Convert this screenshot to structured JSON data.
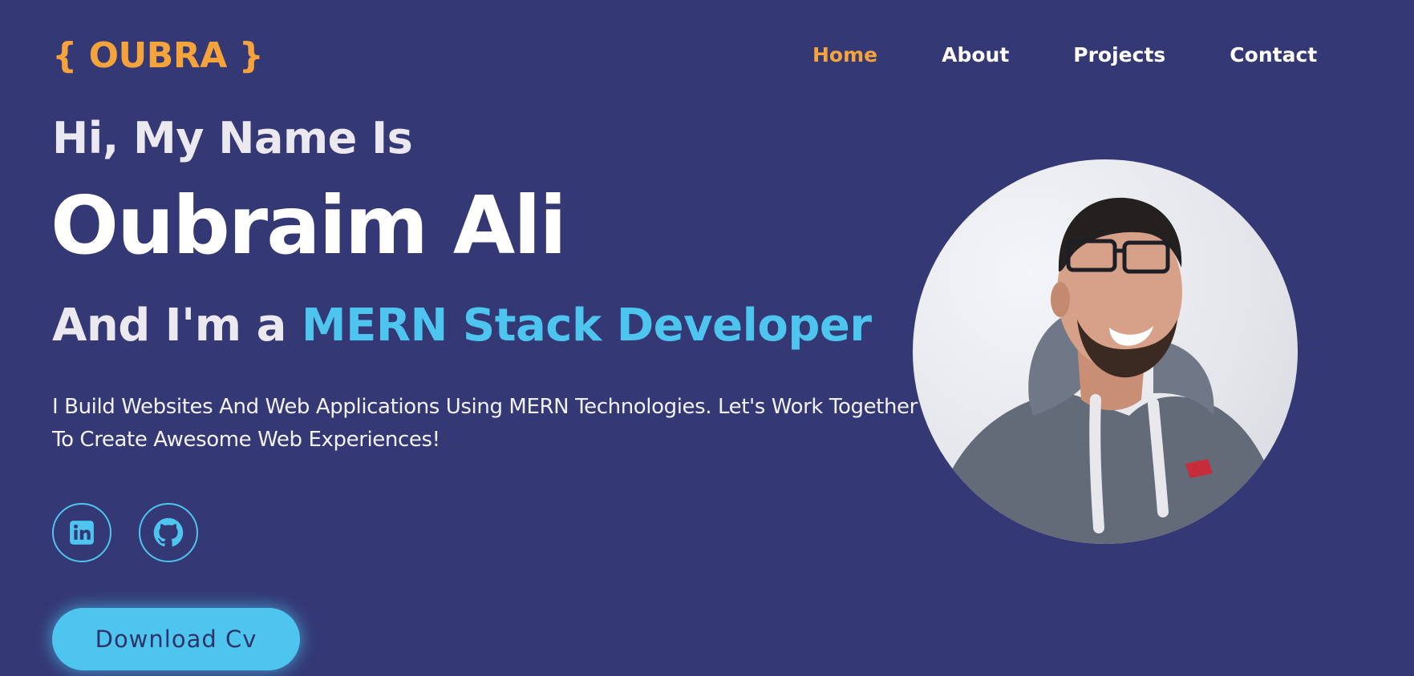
{
  "header": {
    "logo": "{ OUBRA }",
    "nav": [
      {
        "label": "Home",
        "active": true
      },
      {
        "label": "About",
        "active": false
      },
      {
        "label": "Projects",
        "active": false
      },
      {
        "label": "Contact",
        "active": false
      }
    ]
  },
  "hero": {
    "greeting": "Hi, My Name Is",
    "name": "Oubraim Ali",
    "role_prefix": "And I'm a ",
    "role_highlight": "MERN Stack Developer",
    "description": "I Build Websites And Web Applications Using MERN Technologies. Let's Work Together To Create Awesome Web Experiences!",
    "socials": [
      {
        "icon": "linkedin-icon"
      },
      {
        "icon": "github-icon"
      }
    ],
    "cta_label": "Download Cv",
    "photo": "profile-photo"
  },
  "colors": {
    "background": "#343874",
    "accent_orange": "#f5a33a",
    "accent_blue": "#4ec5ef",
    "text": "#ffffff"
  }
}
